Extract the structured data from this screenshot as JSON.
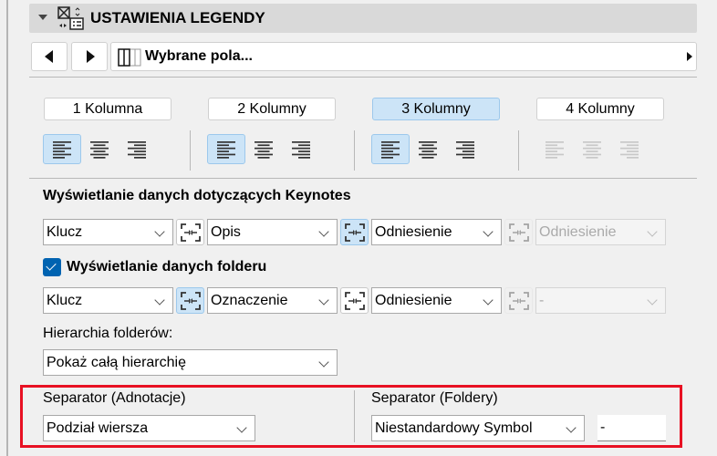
{
  "header": {
    "title": "USTAWIENIA LEGENDY"
  },
  "nav": {
    "field": "Wybrane pola..."
  },
  "columns": [
    {
      "label": "1 Kolumna",
      "selected": false
    },
    {
      "label": "2 Kolumny",
      "selected": false
    },
    {
      "label": "3 Kolumny",
      "selected": true
    },
    {
      "label": "4 Kolumny",
      "selected": false,
      "disabled": true
    }
  ],
  "keynotes": {
    "heading": "Wyświetlanie danych dotyczących Keynotes",
    "fields": [
      "Klucz",
      "Opis",
      "Odniesienie",
      "Odniesienie"
    ]
  },
  "folder": {
    "checkbox_label": "Wyświetlanie danych folderu",
    "checked": true,
    "fields": [
      "Klucz",
      "Oznaczenie",
      "Odniesienie",
      "-"
    ]
  },
  "hierarchy": {
    "label": "Hierarchia folderów:",
    "value": "Pokaż całą hierarchię"
  },
  "separators": {
    "annotations_label": "Separator (Adnotacje)",
    "annotations_value": "Podział wiersza",
    "folders_label": "Separator (Foldery)",
    "folders_value": "Niestandardowy Symbol",
    "custom_symbol": "-"
  },
  "colors": {
    "highlight": "#e81123",
    "accent": "#0063b1",
    "selected": "#cce4f7"
  }
}
